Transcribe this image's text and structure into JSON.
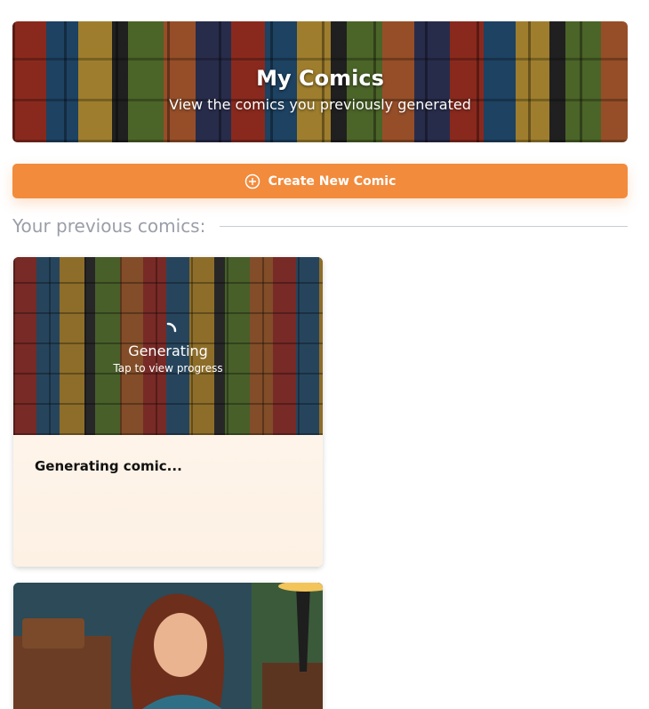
{
  "header": {
    "title": "My Comics",
    "subtitle": "View the comics you previously generated"
  },
  "actions": {
    "create_label": "Create New Comic",
    "create_icon": "plus-circle-icon"
  },
  "section": {
    "title": "Your previous comics:"
  },
  "comics": [
    {
      "status": "Generating",
      "status_hint": "Tap to view progress",
      "title": "Generating comic..."
    },
    {
      "status": "",
      "title": ""
    }
  ],
  "colors": {
    "accent": "#f28b3c",
    "section_text": "#9a9ea8"
  }
}
